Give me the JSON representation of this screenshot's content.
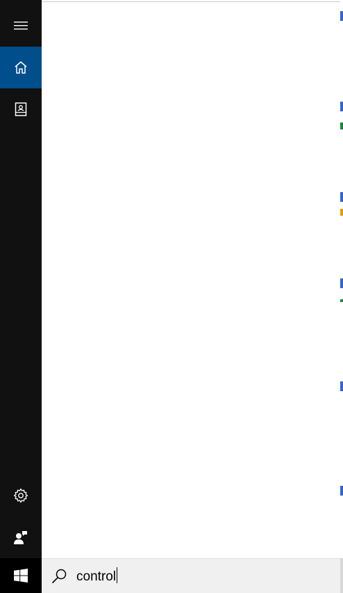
{
  "rail": {
    "items": [
      {
        "icon": "hamburger-menu-icon"
      },
      {
        "icon": "home-icon",
        "selected": true
      },
      {
        "icon": "notebook-icon"
      },
      {
        "icon": "settings-gear-icon"
      },
      {
        "icon": "feedback-person-icon"
      }
    ],
    "selected_color": "#004e8c",
    "background": "#111111"
  },
  "taskbar": {
    "start_icon": "windows-logo-icon",
    "search_icon": "search-magnifier-icon",
    "search_query": "control"
  },
  "colors": {
    "panel": "#ffffff",
    "search_box": "#f0f0f0"
  }
}
